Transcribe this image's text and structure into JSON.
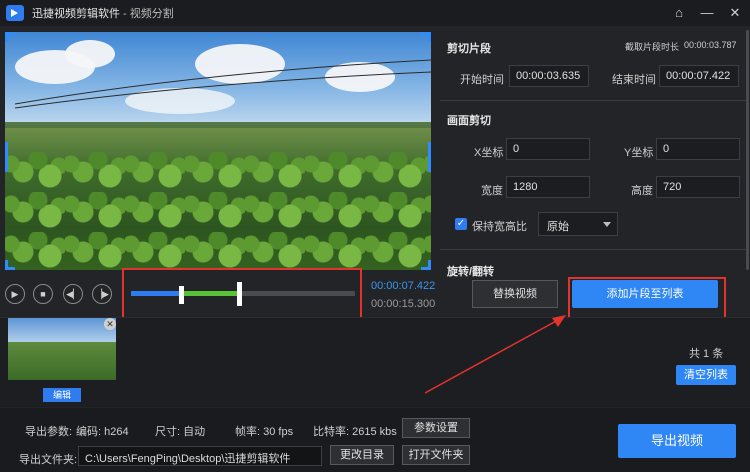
{
  "window": {
    "app_name": "迅捷视频剪辑软件",
    "separator": " - ",
    "subtitle": "视频分割",
    "icons": [
      "home-icon",
      "minimize-icon",
      "close-icon"
    ]
  },
  "player": {
    "current_time": "00:00:07.422",
    "total_time": "00:00:15.300",
    "controls": [
      "play-icon",
      "stop-icon",
      "prev-frame-icon",
      "next-frame-icon"
    ]
  },
  "clip_segment": {
    "title": "剪切片段",
    "duration_label": "截取片段时长",
    "duration_value": "00:00:03.787",
    "start_label": "开始时间",
    "start_value": "00:00:03.635",
    "end_label": "结束时间",
    "end_value": "00:00:07.422"
  },
  "frame_crop": {
    "title": "画面剪切",
    "x_label": "X坐标",
    "x_value": "0",
    "y_label": "Y坐标",
    "y_value": "0",
    "width_label": "宽度",
    "width_value": "1280",
    "height_label": "高度",
    "height_value": "720",
    "keep_ratio_label": "保持宽高比",
    "keep_ratio_checked": true,
    "ratio_option": "原始"
  },
  "rotate": {
    "title": "旋转/翻转"
  },
  "buttons": {
    "replace_video": "替换视频",
    "add_segment": "添加片段至列表",
    "edit": "编辑",
    "clear_list": "清空列表",
    "param_settings": "参数设置",
    "change_dir": "更改目录",
    "open_folder": "打开文件夹",
    "export_video": "导出视频"
  },
  "list": {
    "count_text": "共 1 条"
  },
  "export": {
    "params_label": "导出参数:",
    "codec": "编码: h264",
    "size": "尺寸: 自动",
    "fps": "帧率: 30 fps",
    "bitrate": "比特率: 2615 kbs",
    "folder_label": "导出文件夹:",
    "folder_path": "C:\\Users\\FengPing\\Desktop\\迅捷剪辑软件"
  },
  "colors": {
    "accent": "#2f87f5",
    "annotation": "#e2332c",
    "selected_segment": "#58c334"
  }
}
